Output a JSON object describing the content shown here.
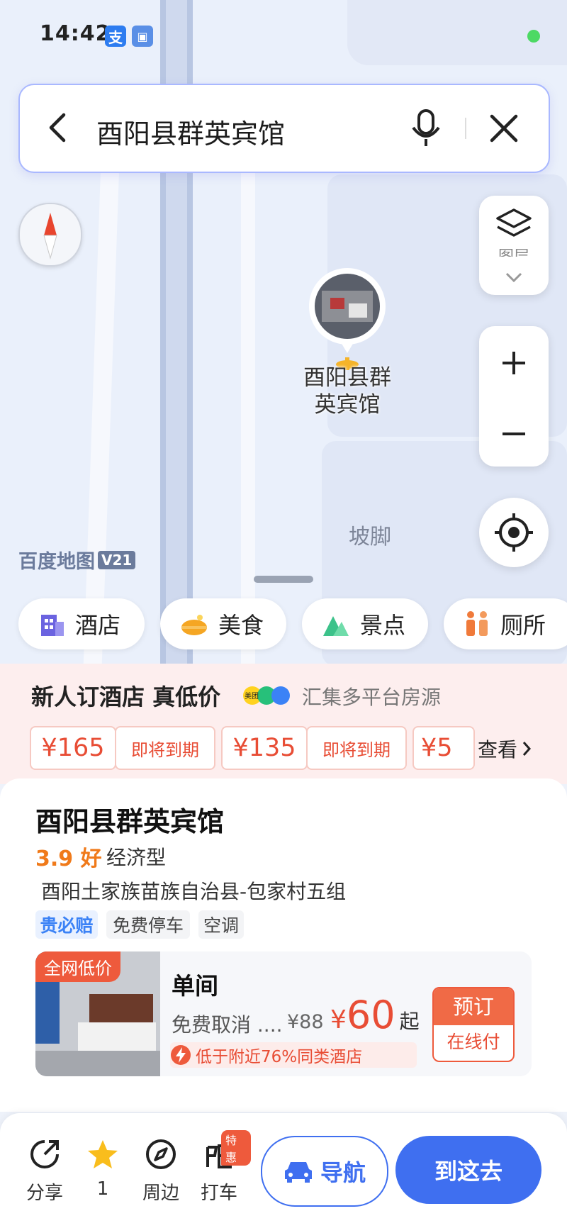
{
  "status_bar": {
    "time": "14:42",
    "icon_a": "支",
    "icon_b": "支"
  },
  "search": {
    "query": "酉阳县群英宾馆"
  },
  "map": {
    "poi_label_line1": "酉阳县群",
    "poi_label_line2": "英宾馆",
    "place_label": "坡脚",
    "logo_text": "百度地图",
    "logo_version": "V21",
    "layers_label": "图层"
  },
  "categories": [
    {
      "label": "酒店",
      "icon": "hotel-icon",
      "color": "#6b63e0"
    },
    {
      "label": "美食",
      "icon": "food-icon",
      "color": "#f5a623"
    },
    {
      "label": "景点",
      "icon": "scenic-icon",
      "color": "#3cc28a"
    },
    {
      "label": "厕所",
      "icon": "toilet-icon",
      "color": "#f07a3a"
    }
  ],
  "promo": {
    "title": "新人订酒店 真低价",
    "subtitle": "汇集多平台房源",
    "badge_meituan": "美团",
    "prices": [
      "¥165",
      "¥135",
      "¥5"
    ],
    "expiring_label": "即将到期",
    "view_more": "查看"
  },
  "hotel": {
    "name": "酉阳县群英宾馆",
    "rating": "3.9 好",
    "type": "经济型",
    "address": "酉阳土家族苗族自治县-包家村五组",
    "tags": [
      "贵必赔",
      "免费停车",
      "空调"
    ],
    "room": {
      "badge": "全网低价",
      "name": "单间",
      "cancel_text": "免费取消 ....",
      "original_price": "¥88",
      "price_symbol": "¥",
      "price_value": "60",
      "price_suffix": "起",
      "note": "低于附近76%同类酒店",
      "book_label": "预订",
      "pay_label": "在线付"
    }
  },
  "bottom_bar": {
    "share": "分享",
    "favorite_count": "1",
    "nearby": "周边",
    "taxi": "打车",
    "taxi_badge": "特惠",
    "navigate": "导航",
    "go_there": "到这去"
  },
  "colors": {
    "accent": "#3f6ff0",
    "price_red": "#e84d35",
    "rating_orange": "#f07a1a"
  }
}
